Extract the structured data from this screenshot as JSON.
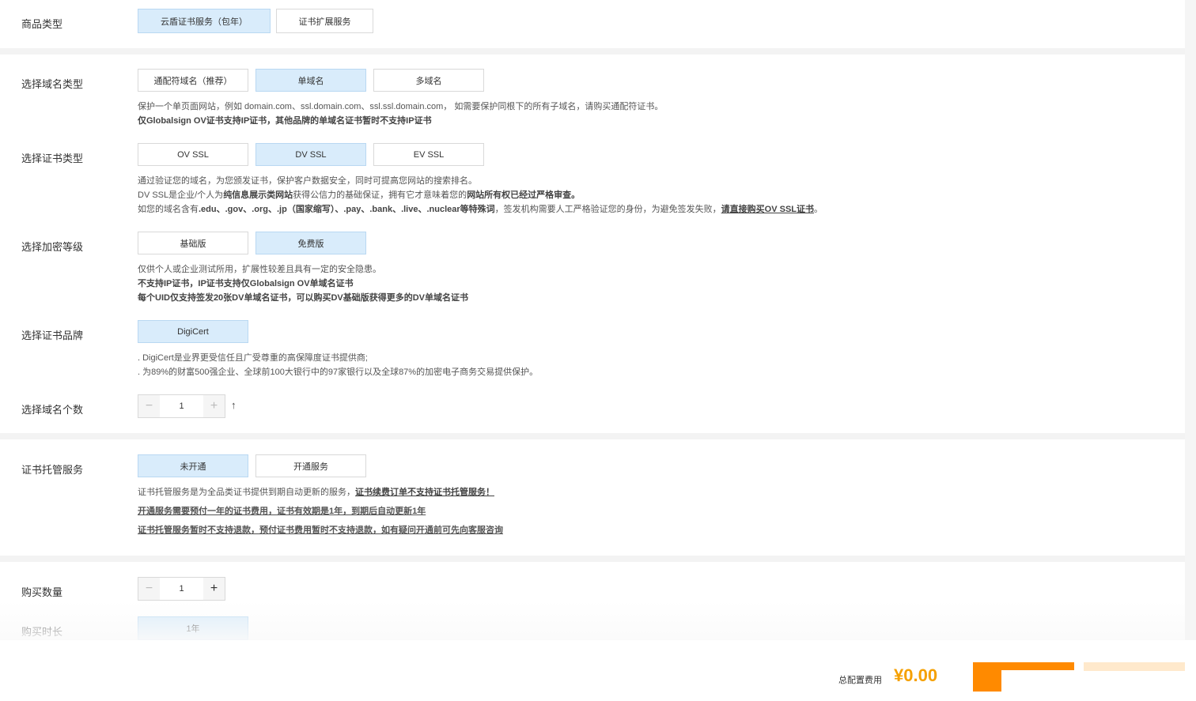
{
  "product_type": {
    "label": "商品类型",
    "options": [
      "云盾证书服务（包年）",
      "证书扩展服务"
    ]
  },
  "domain_type": {
    "label": "选择域名类型",
    "options": [
      "通配符域名（推荐）",
      "单域名",
      "多域名"
    ],
    "desc_line1": "保护一个单页面网站，例如 domain.com、ssl.domain.com、ssl.ssl.domain.com， 如需要保护同根下的所有子域名，请购买通配符证书。",
    "desc_line2": "仅Globalsign OV证书支持IP证书，其他品牌的单域名证书暂时不支持IP证书"
  },
  "cert_type": {
    "label": "选择证书类型",
    "options": [
      "OV SSL",
      "DV SSL",
      "EV SSL"
    ],
    "desc_line1": "通过验证您的域名，为您颁发证书，保护客户数据安全，同时可提高您网站的搜索排名。",
    "desc_line2_a": "DV SSL是企业/个人为",
    "desc_line2_b": "纯信息展示类网站",
    "desc_line2_c": "获得公信力的基础保证，拥有它才意味着您的",
    "desc_line2_d": "网站所有权已经过严格审查。",
    "desc_line3_a": "如您的域名含有",
    "desc_line3_b": ".edu、.gov、.org、.jp（国家缩写）、.pay、.bank、.live、.nuclear等特殊词",
    "desc_line3_c": "，签发机构需要人工严格验证您的身份，为避免签发失败，",
    "desc_line3_link": "请直接购买OV SSL证书",
    "desc_line3_end": "。"
  },
  "encryption": {
    "label": "选择加密等级",
    "options": [
      "基础版",
      "免费版"
    ],
    "desc_line1": "仅供个人或企业测试所用，扩展性较差且具有一定的安全隐患。",
    "desc_line2": "不支持IP证书，IP证书支持仅Globalsign OV单域名证书",
    "desc_line3": "每个UID仅支持签发20张DV单域名证书，可以购买DV基础版获得更多的DV单域名证书"
  },
  "brand": {
    "label": "选择证书品牌",
    "options": [
      "DigiCert"
    ],
    "desc_line1": ". DigiCert是业界更受信任且广受尊重的高保障度证书提供商;",
    "desc_line2": ". 为89%的财富500强企业、全球前100大银行中的97家银行以及全球87%的加密电子商务交易提供保护。"
  },
  "domain_count": {
    "label": "选择域名个数",
    "value": "1",
    "minus": "−",
    "plus": "+",
    "arrow": "↑"
  },
  "hosting": {
    "label": "证书托管服务",
    "options": [
      "未开通",
      "开通服务"
    ],
    "desc_line1_a": "证书托管服务是为全品类证书提供到期自动更新的服务，",
    "desc_line1_link": "证书续费订单不支持证书托管服务！",
    "desc_line2": "开通服务需要预付一年的证书费用，证书有效期是1年，到期后自动更新1年",
    "desc_line3": "证书托管服务暂时不支持退款，预付证书费用暂时不支持退款，如有疑问开通前可先向客服咨询"
  },
  "quantity": {
    "label": "购买数量",
    "value": "1",
    "minus": "−",
    "plus": "+"
  },
  "duration": {
    "label": "购买时长",
    "options": [
      "1年"
    ]
  },
  "footer": {
    "total_label": "总配置费用",
    "total_price": "¥0.00"
  },
  "colors": {
    "selected_bg": "#d9ecfb",
    "price": "#f5a000",
    "buy_button": "#ff8a00",
    "cart_button": "#ffe9cc"
  }
}
